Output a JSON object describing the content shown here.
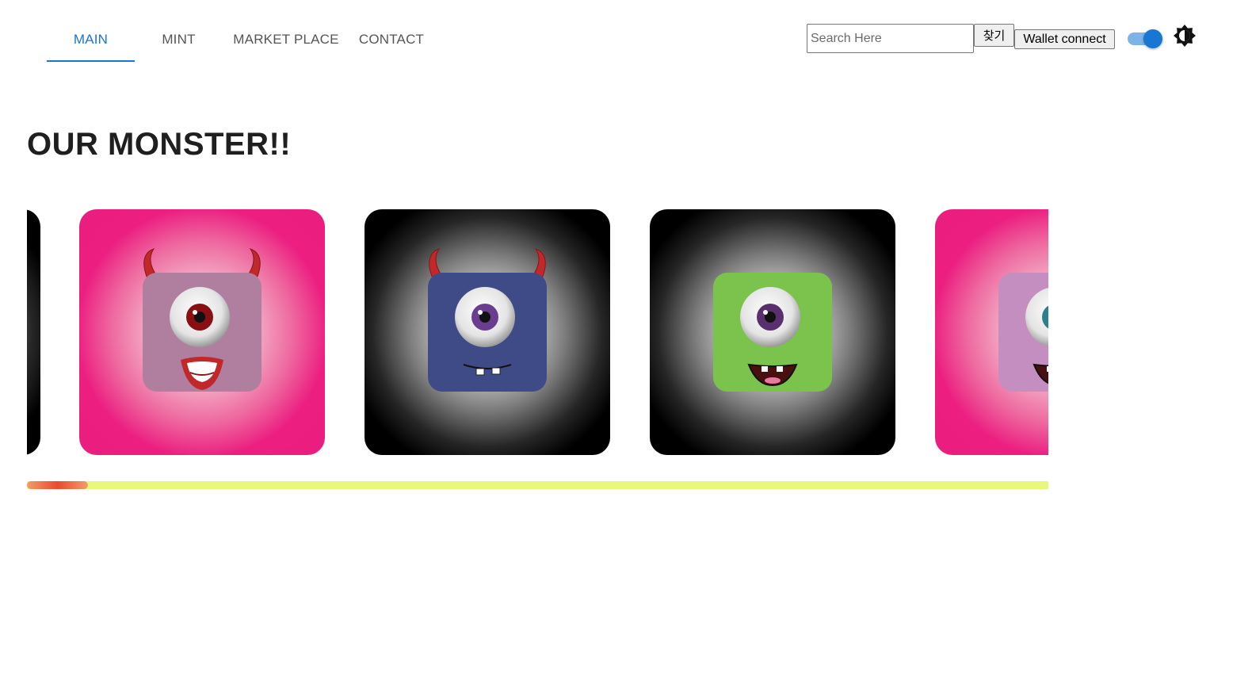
{
  "nav": {
    "tabs": [
      {
        "label": "MAIN",
        "active": true
      },
      {
        "label": "MINT",
        "active": false
      },
      {
        "label": "MARKET PLACE",
        "active": false
      },
      {
        "label": "CONTACT",
        "active": false
      }
    ]
  },
  "search": {
    "placeholder": "Search Here",
    "value": "",
    "button_label": "찾기"
  },
  "wallet": {
    "button_label": "Wallet connect"
  },
  "theme": {
    "toggle_on": true,
    "icon": "brightness-icon"
  },
  "main": {
    "title": "OUR MONSTER!!"
  },
  "carousel": {
    "cards": [
      {
        "background": "black",
        "body_color": "#b07fa0",
        "eye_color": "#8a0f12",
        "horns": "none",
        "partial": "left"
      },
      {
        "background": "pink",
        "body_color": "#b07fa0",
        "eye_color": "#8a0f12",
        "horns": "long",
        "mouth": "lips"
      },
      {
        "background": "black",
        "body_color": "#3f4b87",
        "eye_color": "#6b3d8e",
        "horns": "long",
        "mouth": "teeth"
      },
      {
        "background": "black",
        "body_color": "#7cc34e",
        "eye_color": "#5a2f6e",
        "horns": "short",
        "mouth": "grin"
      },
      {
        "background": "pink",
        "body_color": "#c48fc0",
        "eye_color": "#2f7f8a",
        "horns": "short",
        "mouth": "grin",
        "partial": "right"
      }
    ],
    "progress": 0.06,
    "colors": {
      "track": "#eaf87a",
      "fill": "#e94b2d"
    }
  },
  "colors": {
    "accent": "#1976d2",
    "pink": "#ec1f81"
  }
}
